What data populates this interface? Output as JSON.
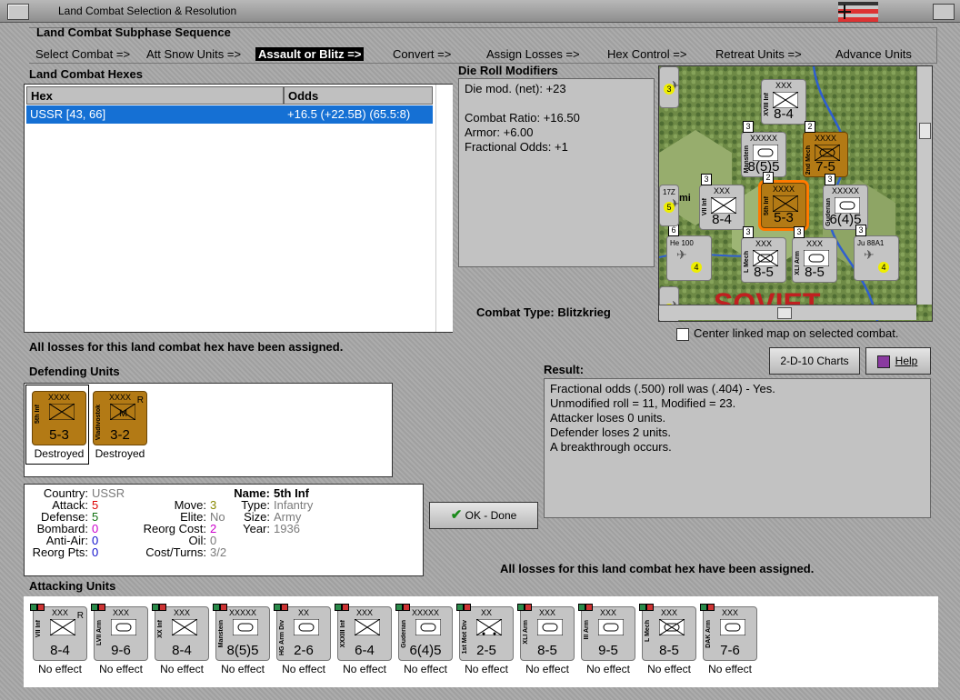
{
  "window": {
    "title": "Land Combat Selection & Resolution"
  },
  "subphase": {
    "header": "Land Combat Subphase Sequence",
    "steps": [
      "Select Combat =>",
      "Att Snow Units =>",
      "Assault or Blitz =>",
      "Convert =>",
      "Assign Losses =>",
      "Hex Control =>",
      "Retreat Units =>",
      "Advance Units"
    ]
  },
  "hexes": {
    "label": "Land Combat Hexes",
    "columns": [
      "Hex",
      "Odds"
    ],
    "rows": [
      {
        "hex": "USSR [43, 66]",
        "odds": "+16.5 (+22.5B) (65.5:8)"
      }
    ]
  },
  "modifiers": {
    "label": "Die Roll Modifiers",
    "lines": [
      "Die mod. (net): +23",
      "",
      "Combat Ratio: +16.50",
      "Armor: +6.00",
      "Fractional Odds: +1"
    ]
  },
  "combat_type": {
    "label": "Combat Type:",
    "value": "Blitzkrieg"
  },
  "center_map": {
    "label": "Center linked map on selected combat."
  },
  "buttons": {
    "charts": "2-D-10 Charts",
    "help": "Help",
    "ok": "OK - Done"
  },
  "losses_msg": "All losses for this land combat hex have been assigned.",
  "result": {
    "label": "Result:",
    "lines": [
      "Fractional odds (.500) roll was (.404)  - Yes.",
      "Unmodified roll = 11, Modified = 23.",
      "Attacker loses 0 units.",
      "Defender loses 2 units.",
      "A breakthrough occurs."
    ]
  },
  "defending": {
    "label": "Defending Units",
    "units": [
      {
        "echelon": "XXXX",
        "name": "5th Inf",
        "strength": "5-3",
        "status": "Destroyed",
        "type": "inf",
        "r": ""
      },
      {
        "echelon": "XXXX",
        "name": "Vladivostok",
        "strength": "3-2",
        "status": "Destroyed",
        "type": "mtn",
        "r": "R"
      }
    ]
  },
  "details": {
    "country_label": "Country:",
    "country": "USSR",
    "attack_label": "Attack:",
    "attack": "5",
    "defense_label": "Defense:",
    "defense": "5",
    "bombard_label": "Bombard:",
    "bombard": "0",
    "antiair_label": "Anti-Air:",
    "antiair": "0",
    "reorgpts_label": "Reorg Pts:",
    "reorgpts": "0",
    "move_label": "Move:",
    "move": "3",
    "elite_label": "Elite:",
    "elite": "No",
    "reorgcost_label": "Reorg Cost:",
    "reorgcost": "2",
    "oil_label": "Oil:",
    "oil": "0",
    "costturns_label": "Cost/Turns:",
    "costturns": "3/2",
    "name_label": "Name:",
    "name": "5th Inf",
    "type_label": "Type:",
    "type": "Infantry",
    "size_label": "Size:",
    "size": "Army",
    "year_label": "Year:",
    "year": "1936"
  },
  "attacking": {
    "label": "Attacking Units",
    "units": [
      {
        "echelon": "XXX",
        "name": "VII Inf",
        "strength": "8-4",
        "status": "No effect",
        "type": "inf",
        "r": "R"
      },
      {
        "echelon": "XXX",
        "name": "LVII Arm",
        "strength": "9-6",
        "status": "No effect",
        "type": "arm",
        "r": ""
      },
      {
        "echelon": "XXX",
        "name": "XX Inf",
        "strength": "8-4",
        "status": "No effect",
        "type": "inf",
        "r": ""
      },
      {
        "echelon": "XXXXX",
        "name": "Manstein",
        "strength": "8(5)5",
        "status": "No effect",
        "type": "arm",
        "r": ""
      },
      {
        "echelon": "XX",
        "name": "HG Arm Div",
        "strength": "2-6",
        "status": "No effect",
        "type": "arm",
        "r": ""
      },
      {
        "echelon": "XXX",
        "name": "XXXIII Inf",
        "strength": "6-4",
        "status": "No effect",
        "type": "inf",
        "r": ""
      },
      {
        "echelon": "XXXXX",
        "name": "Guderian",
        "strength": "6(4)5",
        "status": "No effect",
        "type": "arm",
        "r": ""
      },
      {
        "echelon": "XX",
        "name": "1st Mot Div",
        "strength": "2-5",
        "status": "No effect",
        "type": "mot",
        "r": ""
      },
      {
        "echelon": "XXX",
        "name": "XLI Arm",
        "strength": "8-5",
        "status": "No effect",
        "type": "arm",
        "r": ""
      },
      {
        "echelon": "XXX",
        "name": "III Arm",
        "strength": "9-5",
        "status": "No effect",
        "type": "arm",
        "r": ""
      },
      {
        "echelon": "XXX",
        "name": "L Mech",
        "strength": "8-5",
        "status": "No effect",
        "type": "mech",
        "r": ""
      },
      {
        "echelon": "XXX",
        "name": "DAK Arm",
        "strength": "7-6",
        "status": "No effect",
        "type": "arm",
        "r": ""
      }
    ]
  },
  "map": {
    "region_text": "SOVIET",
    "town_text": "mi",
    "units": [
      {
        "echelon": "XXX",
        "name": "XVIII Inf",
        "strength": "8-4",
        "type": "inf",
        "stack": ""
      },
      {
        "echelon": "XXXXX",
        "name": "Manstein",
        "strength": "8(5)5",
        "type": "arm",
        "stack": "3"
      },
      {
        "echelon": "XXXX",
        "name": "2nd Mech",
        "strength": "7-5",
        "type": "mech",
        "stack": "2"
      },
      {
        "echelon": "XXX",
        "name": "VII Inf",
        "strength": "8-4",
        "type": "inf",
        "stack": "3"
      },
      {
        "echelon": "XXXX",
        "name": "5th Inf",
        "strength": "5-3",
        "type": "inf",
        "stack": "2"
      },
      {
        "echelon": "XXXXX",
        "name": "Guderian",
        "strength": "6(4)5",
        "type": "arm",
        "stack": "3"
      },
      {
        "echelon": "XXX",
        "name": "L Mech",
        "strength": "8-5",
        "type": "mech",
        "stack": "3"
      },
      {
        "echelon": "XXX",
        "name": "XLI Arm",
        "strength": "8-5",
        "type": "arm",
        "stack": "3"
      },
      {
        "echelon": "",
        "name": "He 100",
        "strength": "4",
        "type": "air",
        "stack": "6"
      },
      {
        "echelon": "",
        "name": "Ju 88A1",
        "strength": "4",
        "type": "air",
        "stack": "3"
      },
      {
        "echelon": "",
        "name": "17Z",
        "strength": "5",
        "type": "air",
        "stack": ""
      },
      {
        "echelon": "",
        "name": "",
        "strength": "3",
        "type": "air",
        "stack": ""
      },
      {
        "echelon": "",
        "name": "",
        "strength": "2",
        "type": "air",
        "stack": ""
      }
    ]
  }
}
